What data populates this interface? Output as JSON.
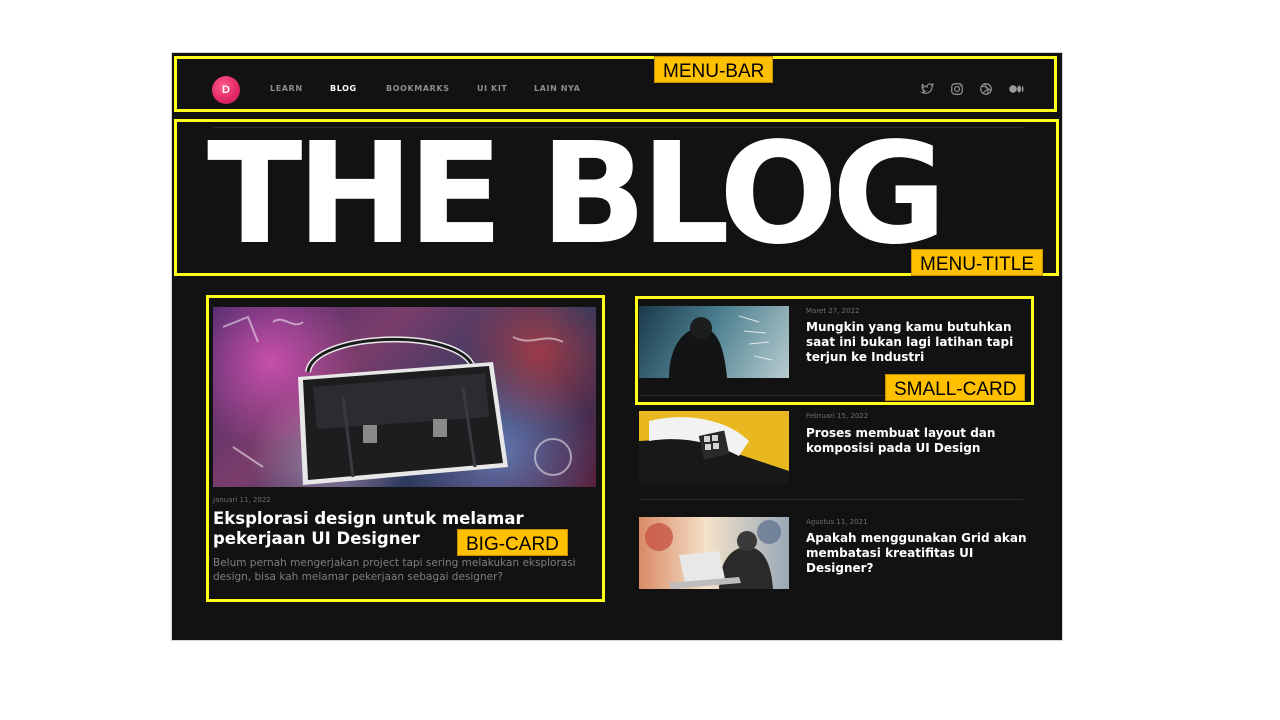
{
  "nav": {
    "logo_letter": "D",
    "items": [
      {
        "label": "LEARN",
        "active": false
      },
      {
        "label": "BLOG",
        "active": true
      },
      {
        "label": "BOOKMARKS",
        "active": false
      },
      {
        "label": "UI KIT",
        "active": false
      },
      {
        "label": "LAIN NYA",
        "active": false
      }
    ],
    "social_icons": [
      "twitter-icon",
      "instagram-icon",
      "dribbble-icon",
      "medium-icon"
    ]
  },
  "hero": {
    "title": "THE BLOG"
  },
  "big_card": {
    "date": "Januari 11, 2022",
    "title": "Eksplorasi design untuk melamar pekerjaan UI Designer",
    "description": "Belum pernah mengerjakan project tapi sering melakukan eksplorasi design, bisa kah melamar pekerjaan sebagai designer?"
  },
  "small_cards": [
    {
      "date": "Maret 27, 2022",
      "title": "Mungkin yang kamu butuhkan saat ini bukan lagi latihan tapi terjun ke Industri"
    },
    {
      "date": "Februari 15, 2022",
      "title": "Proses membuat layout dan komposisi pada UI Design"
    },
    {
      "date": "Agustus 11, 2021",
      "title": "Apakah menggunakan Grid akan membatasi kreatifitas UI Designer?"
    }
  ],
  "annotations": {
    "menu_bar": "MENU-BAR",
    "menu_title": "MENU-TITLE",
    "big_card": "BIG-CARD",
    "small_card": "SMALL-CARD"
  },
  "colors": {
    "annotation_border": "#ffff1a",
    "annotation_label_bg": "#ffc000",
    "page_bg": "#121212",
    "logo": "#e02864"
  }
}
